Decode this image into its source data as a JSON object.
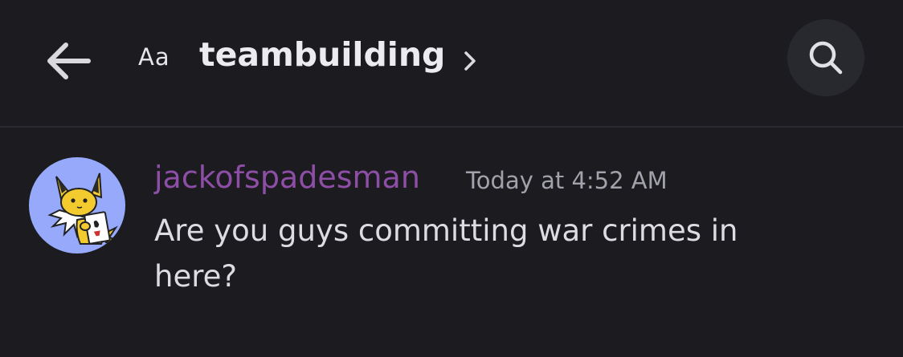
{
  "header": {
    "back_icon": "arrow-left-icon",
    "channel_type": "Aa",
    "channel_name": "teambuilding",
    "chevron_icon": "chevron-right-icon",
    "search_icon": "search-icon"
  },
  "message": {
    "author": "jackofspadesman",
    "timestamp": "Today at 4:52 AM",
    "content": "Are you guys committing war crimes in here?",
    "avatar_icon": "jolteon-holding-playing-card-avatar"
  },
  "colors": {
    "background": "#1b1b20",
    "author": "#8d4ea6",
    "avatar_bg": "#97a9fb",
    "search_bg": "#28282f"
  }
}
